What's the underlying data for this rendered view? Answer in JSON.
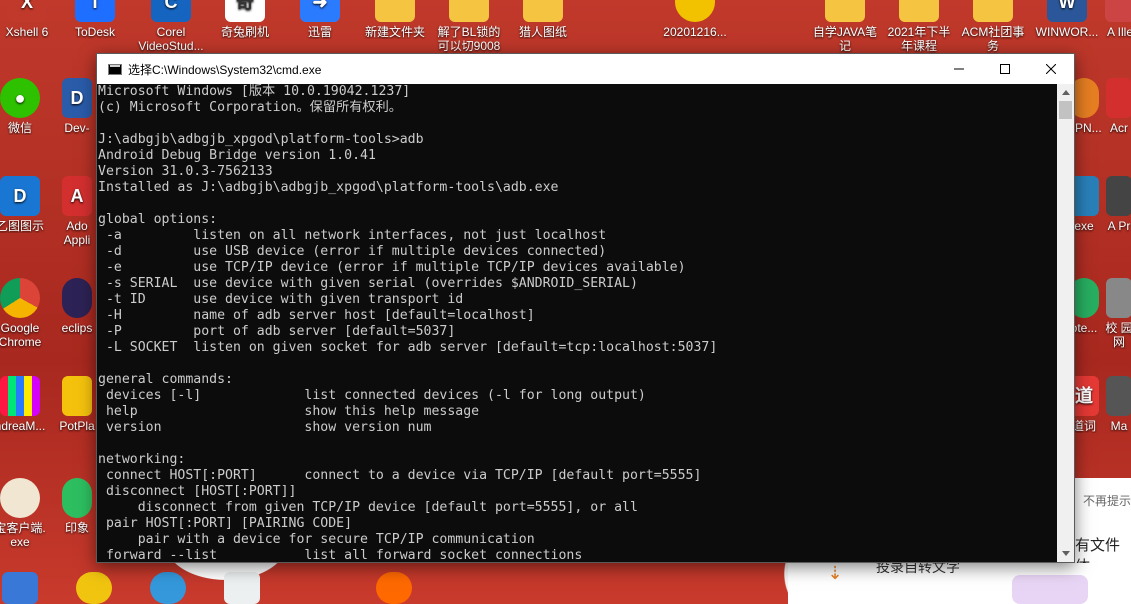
{
  "window": {
    "title": "选择C:\\Windows\\System32\\cmd.exe",
    "minimize_label": "—",
    "maximize_label": "☐",
    "close_label": "✕"
  },
  "console": {
    "lines": [
      "Microsoft Windows [版本 10.0.19042.1237]",
      "(c) Microsoft Corporation。保留所有权利。",
      "",
      "J:\\adbgjb\\adbgjb_xpgod\\platform-tools>adb",
      "Android Debug Bridge version 1.0.41",
      "Version 31.0.3-7562133",
      "Installed as J:\\adbgjb\\adbgjb_xpgod\\platform-tools\\adb.exe",
      "",
      "global options:",
      " -a         listen on all network interfaces, not just localhost",
      " -d         use USB device (error if multiple devices connected)",
      " -e         use TCP/IP device (error if multiple TCP/IP devices available)",
      " -s SERIAL  use device with given serial (overrides $ANDROID_SERIAL)",
      " -t ID      use device with given transport id",
      " -H         name of adb server host [default=localhost]",
      " -P         port of adb server [default=5037]",
      " -L SOCKET  listen on given socket for adb server [default=tcp:localhost:5037]",
      "",
      "general commands:",
      " devices [-l]             list connected devices (-l for long output)",
      " help                     show this help message",
      " version                  show version num",
      "",
      "networking:",
      " connect HOST[:PORT]      connect to a device via TCP/IP [default port=5555]",
      " disconnect [HOST[:PORT]]",
      "     disconnect from given TCP/IP device [default port=5555], or all",
      " pair HOST[:PORT] [PAIRING CODE]",
      "     pair with a device for secure TCP/IP communication",
      " forward --list           list all forward socket connections"
    ]
  },
  "desktop": {
    "left_icons": [
      {
        "label": "Xshell 6",
        "icon": "xshell-icon",
        "color": "#c0392b"
      },
      {
        "label": "ToDesk",
        "icon": "todesk-icon",
        "color": "#1e6fff"
      },
      {
        "label": "Corel VideoStud...",
        "icon": "corel-icon",
        "color": "#1565c0"
      },
      {
        "label": "奇兔刷机",
        "icon": "qitu-icon",
        "color": "#ffffff"
      },
      {
        "label": "迅雷",
        "icon": "xunlei-icon",
        "color": "#2b7bff"
      },
      {
        "label": "新建文件夹",
        "icon": "folder-icon",
        "color": "#f5c542"
      },
      {
        "label": "解了BL锁的 可以切9008",
        "icon": "folder-icon",
        "color": "#f5c542"
      },
      {
        "label": "猎人图纸",
        "icon": "folder-icon",
        "color": "#f5c542"
      },
      {
        "label": "20201216...",
        "icon": "image-icon",
        "color": "#f2c200"
      }
    ],
    "right_icons": [
      {
        "label": "自学JAVA笔 记",
        "icon": "folder-icon",
        "color": "#f5c542"
      },
      {
        "label": "2021年下半 年课程",
        "icon": "folder-icon",
        "color": "#f5c542"
      },
      {
        "label": "ACM社团事 务",
        "icon": "folder-icon",
        "color": "#f5c542"
      },
      {
        "label": "WINWOR...",
        "icon": "word-icon",
        "color": "#2b579a"
      },
      {
        "label": "A Ille",
        "icon": "app-icon",
        "color": "#cc4444"
      }
    ],
    "side_left": [
      {
        "label": "微信",
        "icon": "wechat-icon",
        "color": "#2dc100"
      },
      {
        "label": "Dev-",
        "icon": "devcpp-icon",
        "color": "#2a5caa"
      },
      {
        "label": "乙图图示",
        "icon": "draw-icon",
        "color": "#1976d2"
      },
      {
        "label": "Ado Appli",
        "icon": "adobe-icon",
        "color": "#d32f2f"
      },
      {
        "label": "Google Chrome",
        "icon": "chrome-icon",
        "color": "#4285f4"
      },
      {
        "label": "eclips",
        "icon": "eclipse-icon",
        "color": "#2c2255"
      },
      {
        "label": "ndreaM...",
        "icon": "grid-icon",
        "color": "#ff5722"
      },
      {
        "label": "PotPla",
        "icon": "potplayer-icon",
        "color": "#f4c20d"
      },
      {
        "label": "宝客户端. exe",
        "icon": "bao-icon",
        "color": "#f0e6d2"
      },
      {
        "label": "印象",
        "icon": "evernote-icon",
        "color": "#2dbe60"
      }
    ],
    "side_right": [
      {
        "label": "RPN...",
        "icon": "app-icon",
        "color": "#e67e22"
      },
      {
        "label": "Acr",
        "icon": "acrobat-icon",
        "color": "#d32f2f"
      },
      {
        "label": "exe",
        "icon": "shield-icon",
        "color": "#2980b9"
      },
      {
        "label": "A Pr",
        "icon": "app-icon",
        "color": "#444444"
      },
      {
        "label": "ote...",
        "icon": "app-icon",
        "color": "#27ae60"
      },
      {
        "label": "校 园网",
        "icon": "app-icon",
        "color": "#888888"
      },
      {
        "label": "道词",
        "icon": "youdao-icon",
        "color": "#e53935"
      },
      {
        "label": "Ma",
        "icon": "app-icon",
        "color": "#555555"
      },
      {
        "label": "不再提示",
        "icon": "text-icon",
        "color": "#666666"
      },
      {
        "label": "有文件体",
        "icon": "text-icon",
        "color": "#222222"
      }
    ],
    "bottom_text": "投录自转文字"
  }
}
